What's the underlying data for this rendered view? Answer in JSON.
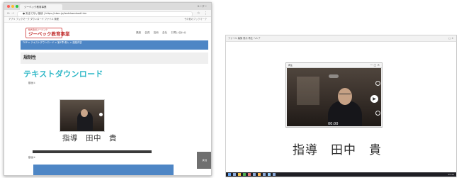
{
  "left_screenshot": {
    "browser": {
      "tab_title": "ジーベック教育事業",
      "url": "● 安全でない接続 | https://xbec.jp/textdownload.htm",
      "bookmarks": "アプリ   ブックマーク   ダウンロード  ファイル  管理",
      "bookmarks_right": "その他のブックマーク",
      "window_text": "ユーザー"
    },
    "site": {
      "logo_small": "株式会社ジーベック",
      "logo_main": "ジーベック教育事業",
      "nav": "講座  会員  技術  会社  お問い合わせ",
      "banner_text": "TOP > テキストダウンロード > 第1章 導入 > 講座内容",
      "section_title": "規制性",
      "page_heading": "テキストダウンロード",
      "label_1": "動画①",
      "caption": "指導　田中　貴",
      "label_2": "動画②",
      "button_label": "戻る"
    }
  },
  "right_screenshot": {
    "topbar_text": "ファイル  編集  表示  再生  ヘルプ",
    "topbar_right": "□  ✕",
    "player": {
      "title": "再生",
      "controls": "—  □  ✕",
      "time": "00:00",
      "play_symbol": "▶"
    },
    "caption": "指導　田中　貴",
    "taskbar_time": "15:42"
  },
  "colors": {
    "heading_teal": "#2fb8c7",
    "banner_blue": "#4e86c5",
    "logo_red": "#c23232"
  }
}
